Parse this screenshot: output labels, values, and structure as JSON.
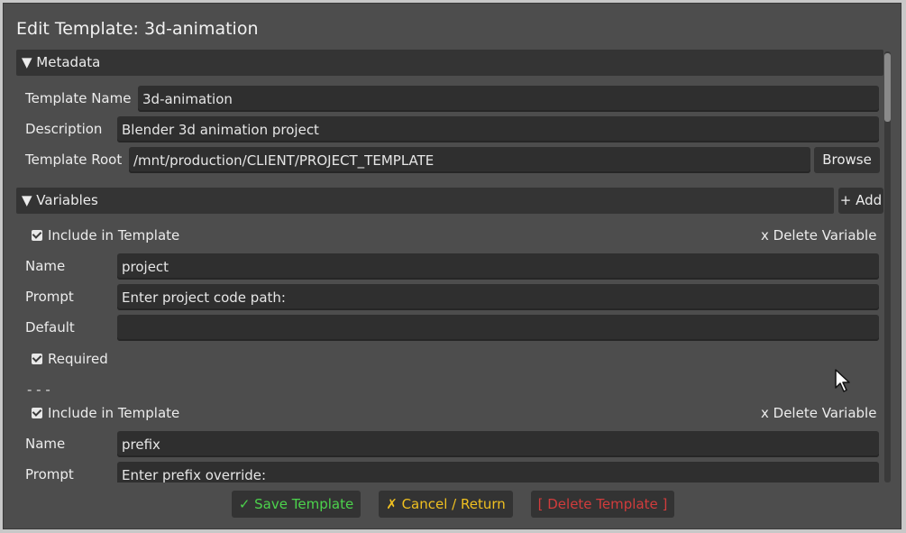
{
  "window": {
    "title": "Edit Template: 3d-animation"
  },
  "metadata": {
    "header": "▼ Metadata",
    "template_name_label": "Template Name",
    "template_name_value": "3d-animation",
    "description_label": "Description",
    "description_value": "Blender 3d animation project",
    "template_root_label": "Template Root",
    "template_root_value": "/mnt/production/CLIENT/PROJECT_TEMPLATE",
    "browse_label": "Browse"
  },
  "variables": {
    "header": "▼ Variables",
    "add_label": "+ Add",
    "separator": "- - -",
    "items": [
      {
        "include_label": "Include in Template",
        "include_checked": true,
        "delete_label": "x Delete Variable",
        "name_label": "Name",
        "name_value": "project",
        "prompt_label": "Prompt",
        "prompt_value": "Enter project code path:",
        "default_label": "Default",
        "default_value": "",
        "required_label": "Required",
        "required_checked": true
      },
      {
        "include_label": "Include in Template",
        "include_checked": true,
        "delete_label": "x Delete Variable",
        "name_label": "Name",
        "name_value": "prefix",
        "prompt_label": "Prompt",
        "prompt_value": "Enter prefix override:"
      }
    ]
  },
  "footer": {
    "save_label": "✓ Save Template",
    "cancel_label": "✗ Cancel / Return",
    "delete_label": "[ Delete Template ]"
  },
  "colors": {
    "save": "#4cd34c",
    "cancel": "#f0c020",
    "delete": "#d23c3c"
  }
}
